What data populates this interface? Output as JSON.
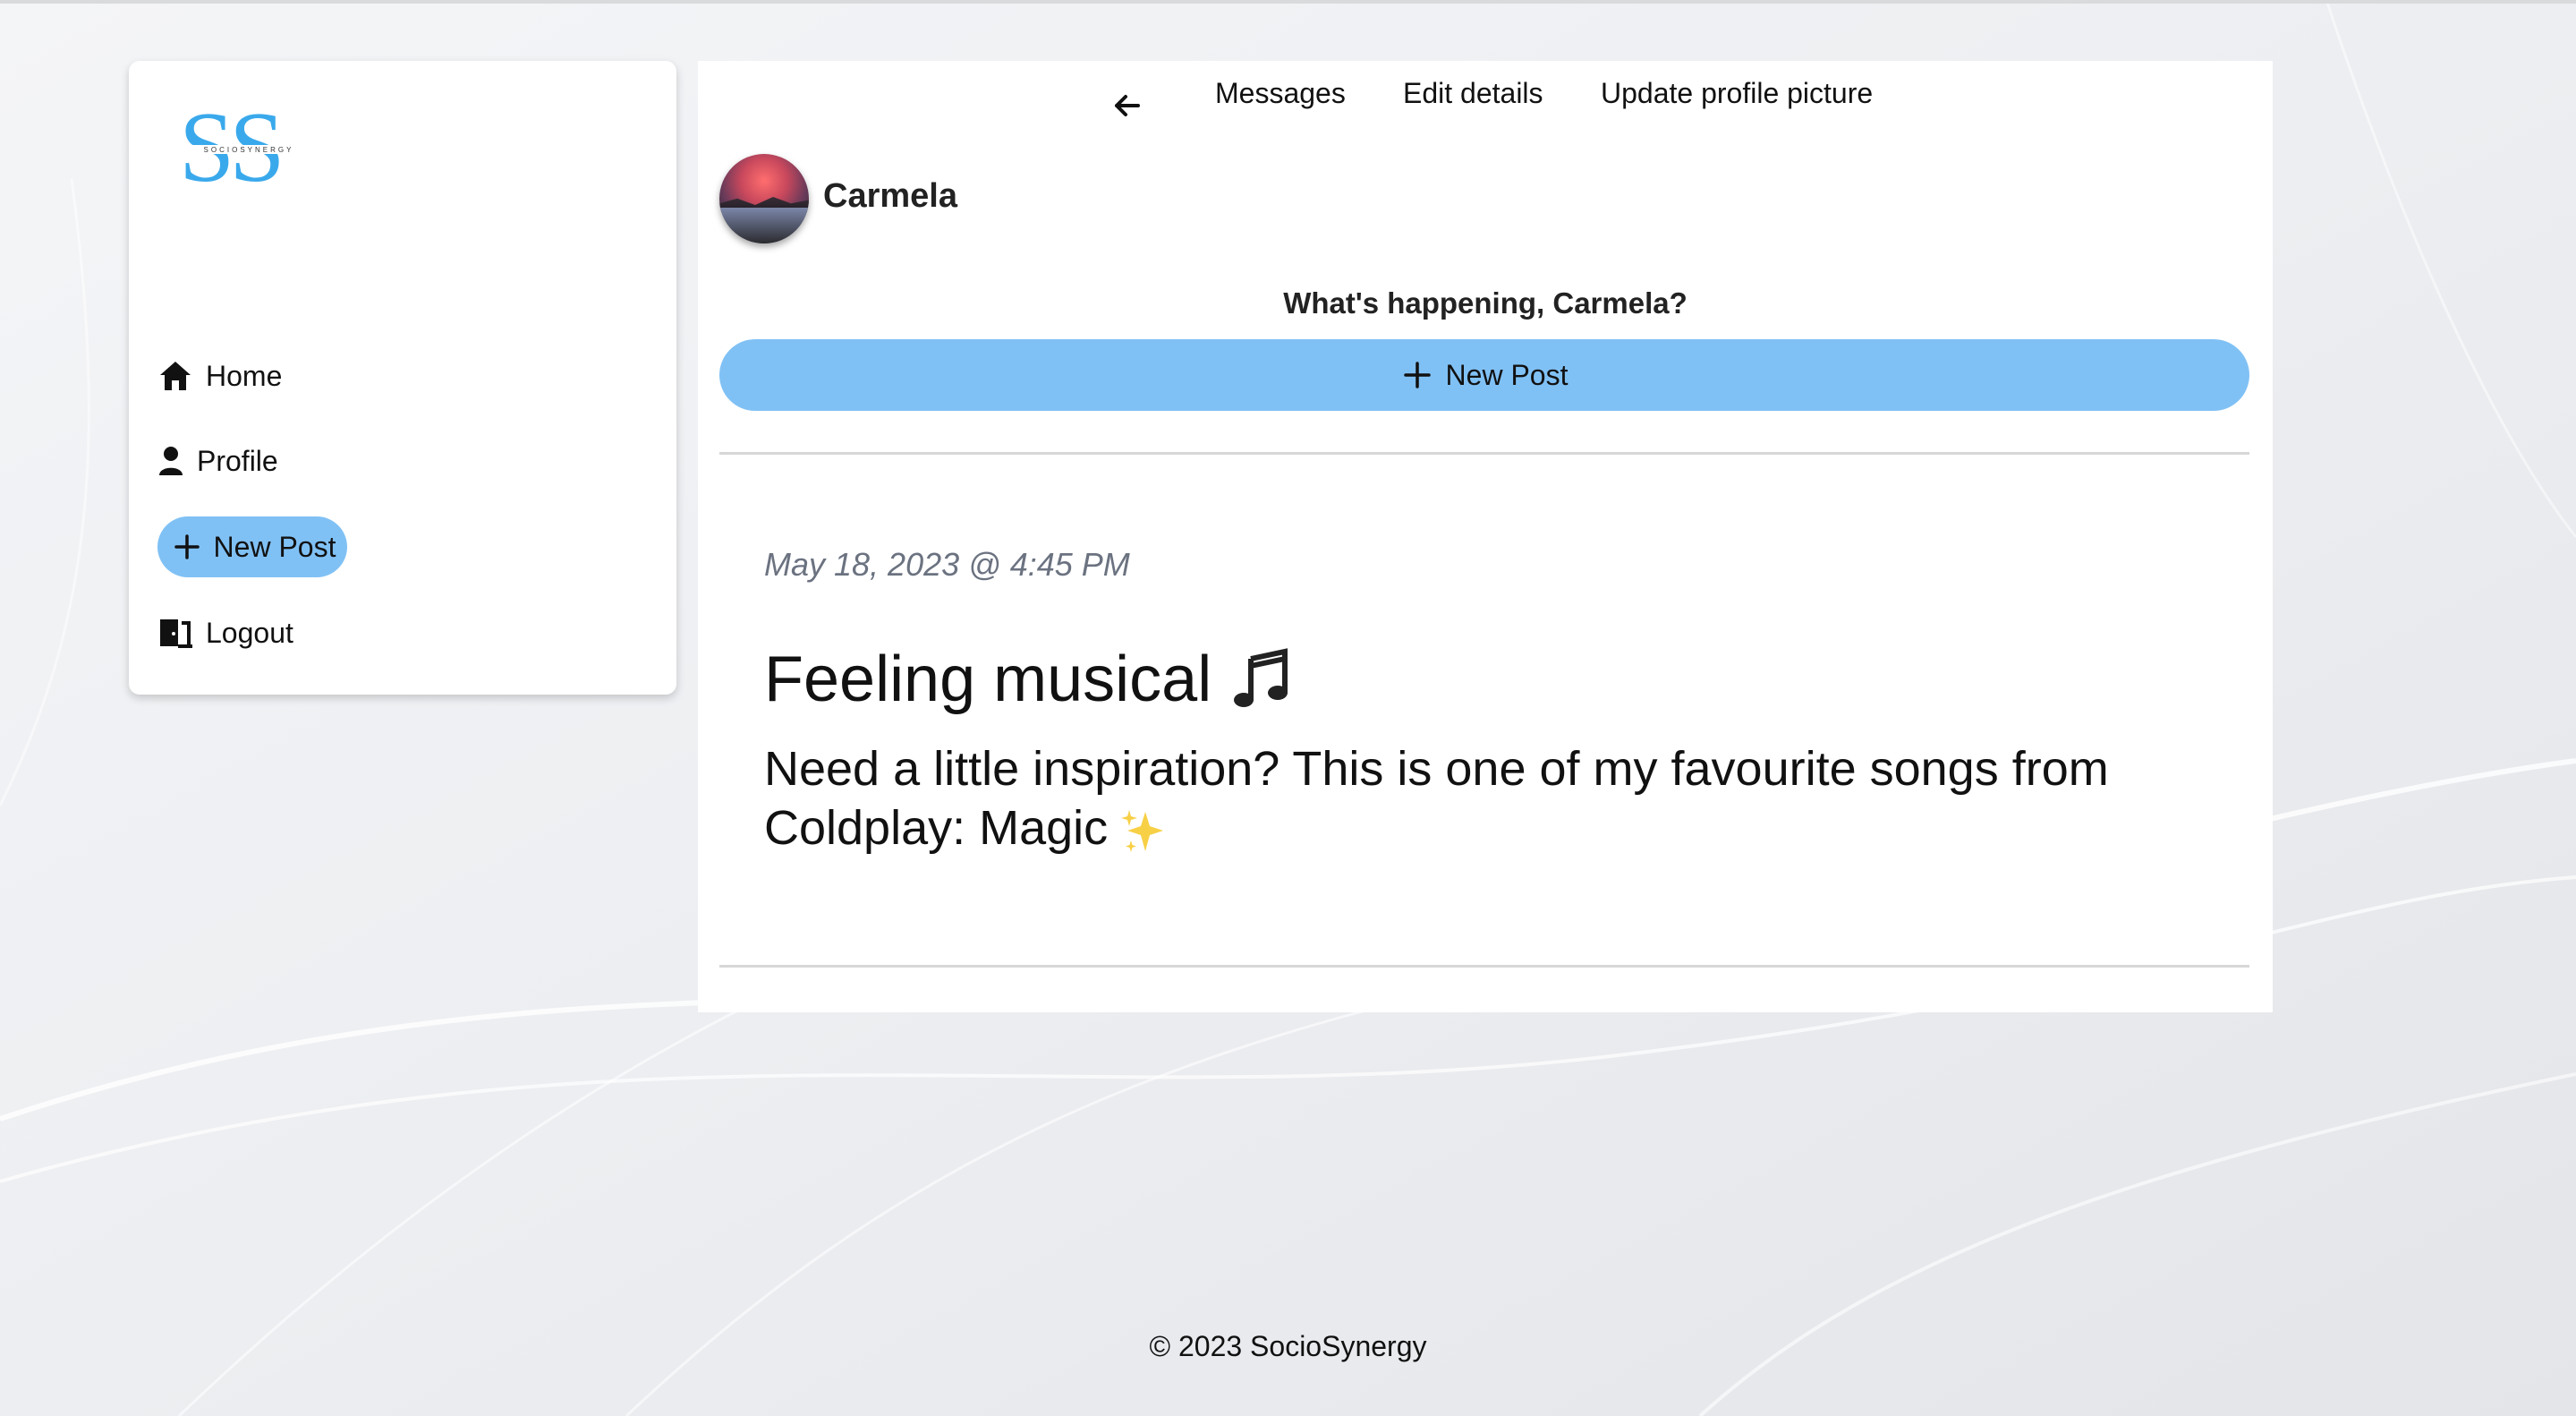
{
  "brand": {
    "logo_letters": "SS",
    "logo_tagline": "SOCIOSYNERGY",
    "color": "#3aa9ec"
  },
  "sidebar": {
    "items": [
      {
        "label": "Home",
        "icon": "home-icon"
      },
      {
        "label": "Profile",
        "icon": "person-icon"
      },
      {
        "label": "New Post",
        "icon": "plus-icon"
      },
      {
        "label": "Logout",
        "icon": "door-icon"
      }
    ]
  },
  "topnav": {
    "back_icon": "arrow-left-icon",
    "links": [
      "Messages",
      "Edit details",
      "Update profile picture"
    ]
  },
  "profile": {
    "name": "Carmela",
    "prompt": "What's happening, Carmela?"
  },
  "compose": {
    "button_label": "New Post",
    "button_color": "#80c1f5"
  },
  "post": {
    "date": "May 18, 2023 @ 4:45 PM",
    "title": "Feeling musical",
    "title_emoji": "music-note-icon",
    "body": "Need a little inspiration? This is one of my favourite songs from Coldplay: Magic",
    "body_emoji": "sparkles-icon"
  },
  "footer": {
    "text": "© 2023 SocioSynergy"
  }
}
